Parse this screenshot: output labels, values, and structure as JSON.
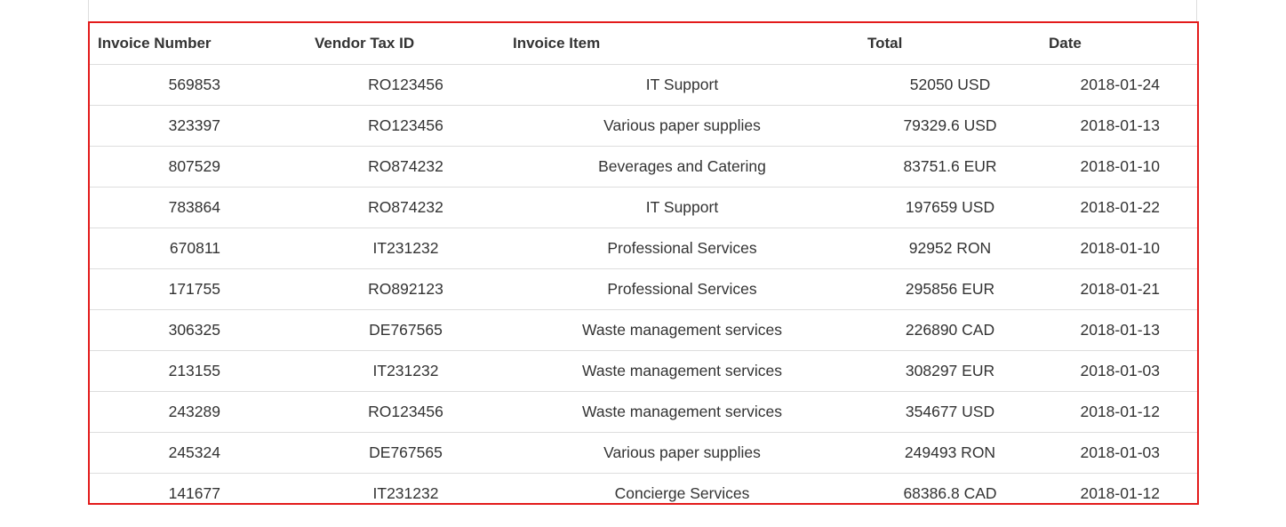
{
  "table": {
    "headers": {
      "invoice_number": "Invoice Number",
      "vendor_tax_id": "Vendor Tax ID",
      "invoice_item": "Invoice Item",
      "total": "Total",
      "date": "Date"
    },
    "rows": [
      {
        "invoice_number": "569853",
        "vendor_tax_id": "RO123456",
        "invoice_item": "IT Support",
        "total": "52050 USD",
        "date": "2018-01-24"
      },
      {
        "invoice_number": "323397",
        "vendor_tax_id": "RO123456",
        "invoice_item": "Various paper supplies",
        "total": "79329.6 USD",
        "date": "2018-01-13"
      },
      {
        "invoice_number": "807529",
        "vendor_tax_id": "RO874232",
        "invoice_item": "Beverages and Catering",
        "total": "83751.6 EUR",
        "date": "2018-01-10"
      },
      {
        "invoice_number": "783864",
        "vendor_tax_id": "RO874232",
        "invoice_item": "IT Support",
        "total": "197659 USD",
        "date": "2018-01-22"
      },
      {
        "invoice_number": "670811",
        "vendor_tax_id": "IT231232",
        "invoice_item": "Professional Services",
        "total": "92952 RON",
        "date": "2018-01-10"
      },
      {
        "invoice_number": "171755",
        "vendor_tax_id": "RO892123",
        "invoice_item": "Professional Services",
        "total": "295856 EUR",
        "date": "2018-01-21"
      },
      {
        "invoice_number": "306325",
        "vendor_tax_id": "DE767565",
        "invoice_item": "Waste management services",
        "total": "226890 CAD",
        "date": "2018-01-13"
      },
      {
        "invoice_number": "213155",
        "vendor_tax_id": "IT231232",
        "invoice_item": "Waste management services",
        "total": "308297 EUR",
        "date": "2018-01-03"
      },
      {
        "invoice_number": "243289",
        "vendor_tax_id": "RO123456",
        "invoice_item": "Waste management services",
        "total": "354677 USD",
        "date": "2018-01-12"
      },
      {
        "invoice_number": "245324",
        "vendor_tax_id": "DE767565",
        "invoice_item": "Various paper supplies",
        "total": "249493 RON",
        "date": "2018-01-03"
      },
      {
        "invoice_number": "141677",
        "vendor_tax_id": "IT231232",
        "invoice_item": "Concierge Services",
        "total": "68386.8 CAD",
        "date": "2018-01-12"
      }
    ]
  },
  "colors": {
    "highlight_border": "#e31b1b",
    "row_divider": "#dddddd",
    "text": "#333333"
  }
}
